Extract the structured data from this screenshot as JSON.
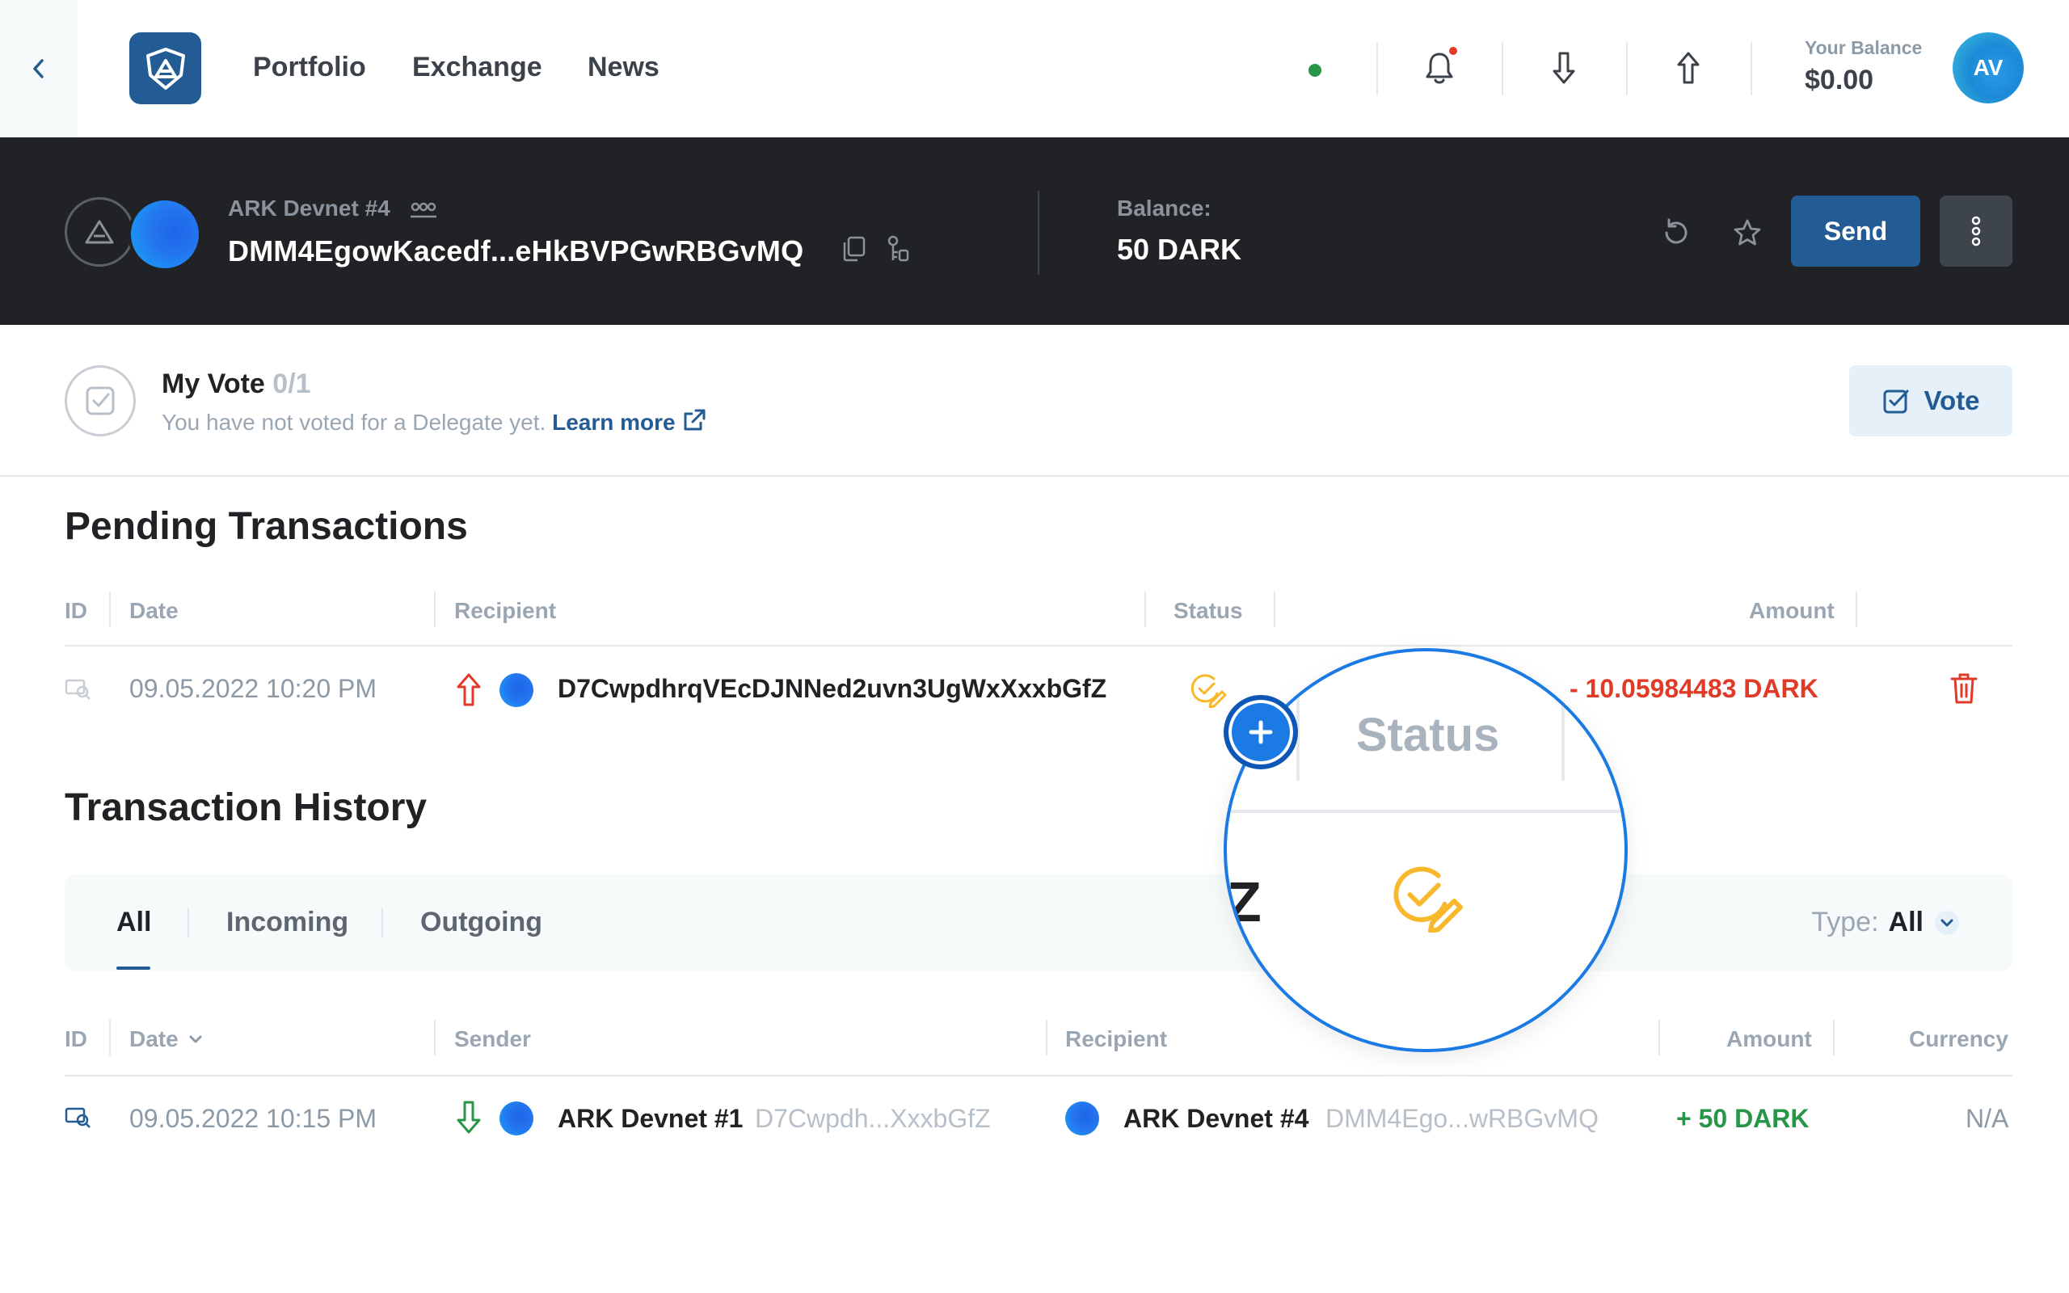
{
  "nav": {
    "links": [
      "Portfolio",
      "Exchange",
      "News"
    ],
    "balance_label": "Your Balance",
    "balance_value": "$0.00",
    "avatar_initials": "AV"
  },
  "wallet": {
    "name": "ARK Devnet #4",
    "address": "DMM4EgowKacedf...eHkBVPGwRBGvMQ",
    "balance_label": "Balance:",
    "balance": "50 DARK",
    "send_label": "Send"
  },
  "vote": {
    "title": "My Vote",
    "count": "0/1",
    "subtitle": "You have not voted for a Delegate yet.",
    "learn_more": "Learn more",
    "button": "Vote"
  },
  "pending": {
    "title": "Pending Transactions",
    "headers": [
      "ID",
      "Date",
      "Recipient",
      "Status",
      "Amount"
    ],
    "rows": [
      {
        "date": "09.05.2022 10:20 PM",
        "recipient": "D7CwpdhrqVEcDJNNed2uvn3UgWxXxxbGfZ",
        "amount": "- 10.05984483 DARK"
      }
    ]
  },
  "history": {
    "title": "Transaction History",
    "tabs": [
      "All",
      "Incoming",
      "Outgoing"
    ],
    "type_label": "Type:",
    "type_value": "All",
    "headers": [
      "ID",
      "Date",
      "Sender",
      "Recipient",
      "Amount",
      "Currency"
    ],
    "rows": [
      {
        "date": "09.05.2022 10:15 PM",
        "sender_name": "ARK Devnet #1",
        "sender_addr": "D7Cwpdh...XxxbGfZ",
        "recipient_name": "ARK Devnet #4",
        "recipient_addr": "DMM4Ego...wRBGvMQ",
        "amount": "+ 50 DARK",
        "currency": "N/A"
      }
    ]
  },
  "magnifier": {
    "label": "Status",
    "fragment": "Z"
  },
  "colors": {
    "brand": "#235b95",
    "negative": "#e13a26",
    "positive": "#289548",
    "pending": "#f9b82b",
    "highlight": "#1b7ae4"
  }
}
